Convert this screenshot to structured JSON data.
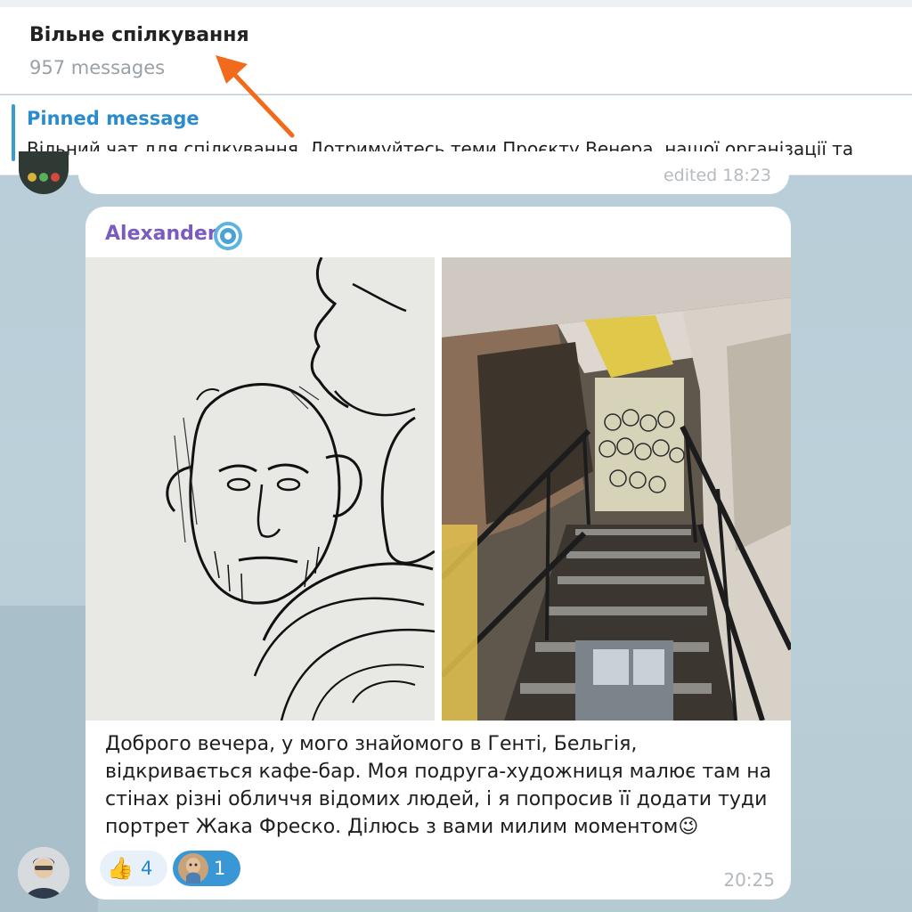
{
  "header": {
    "title": "Вільне спілкування",
    "subtitle": "957 messages"
  },
  "pinned": {
    "title": "Pinned message",
    "text": "Вільний чат для спілкування. Дотримуйтесь теми Проєкту Венера, нашої організації та"
  },
  "previous_message": {
    "edited_label": "edited 18:23"
  },
  "message": {
    "sender": "Alexander",
    "lines": [
      "Доброго вечера, у мого знайомого в Генті, Бельгія,",
      "відкривається кафе-бар. Моя подруга-художниця малює там на",
      "стінах різні обличчя відомих людей, і я попросив її додати туди",
      "портрет Жака Фреско. Ділюсь з вами милим моментом😉"
    ],
    "time": "20:25",
    "reactions": [
      {
        "emoji": "👍",
        "count": "4"
      },
      {
        "emoji": "custom-sticker",
        "count": "1"
      }
    ]
  },
  "icons": {
    "verified": "verified-badge-icon",
    "annotation": "orange-arrow"
  },
  "colors": {
    "accent": "#2a8ccc",
    "sender": "#7a5bbf",
    "arrow": "#f26a1b",
    "reaction_active": "#3a97d6"
  }
}
